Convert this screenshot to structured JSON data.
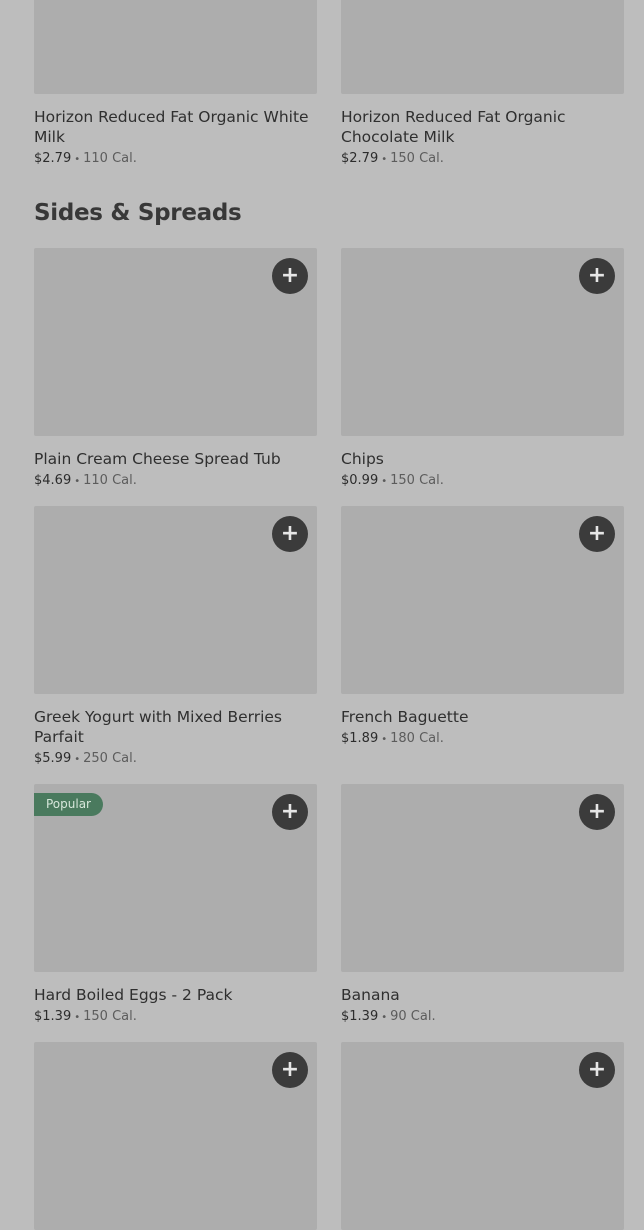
{
  "top_items": [
    {
      "name": "Horizon Reduced Fat Organic White Milk",
      "price": "$2.79",
      "calories": "110 Cal."
    },
    {
      "name": "Horizon Reduced Fat Organic Chocolate Milk",
      "price": "$2.79",
      "calories": "150 Cal."
    }
  ],
  "section": {
    "title": "Sides & Spreads"
  },
  "add_icon": "+",
  "items": [
    {
      "name": "Plain Cream Cheese Spread Tub",
      "price": "$4.69",
      "calories": "110 Cal."
    },
    {
      "name": "Chips",
      "price": "$0.99",
      "calories": "150 Cal."
    },
    {
      "name": "Greek Yogurt with Mixed Berries Parfait",
      "price": "$5.99",
      "calories": "250 Cal."
    },
    {
      "name": "French Baguette",
      "price": "$1.89",
      "calories": "180 Cal."
    },
    {
      "name": "Hard Boiled Eggs - 2 Pack",
      "price": "$1.39",
      "calories": "150 Cal.",
      "badge": "Popular"
    },
    {
      "name": "Banana",
      "price": "$1.39",
      "calories": "90 Cal."
    }
  ],
  "separator": "•",
  "colors": {
    "background": "#bdbdbd",
    "image_placeholder": "#adadad",
    "add_button": "#3b3b3b",
    "badge": "#4a7a5e"
  }
}
